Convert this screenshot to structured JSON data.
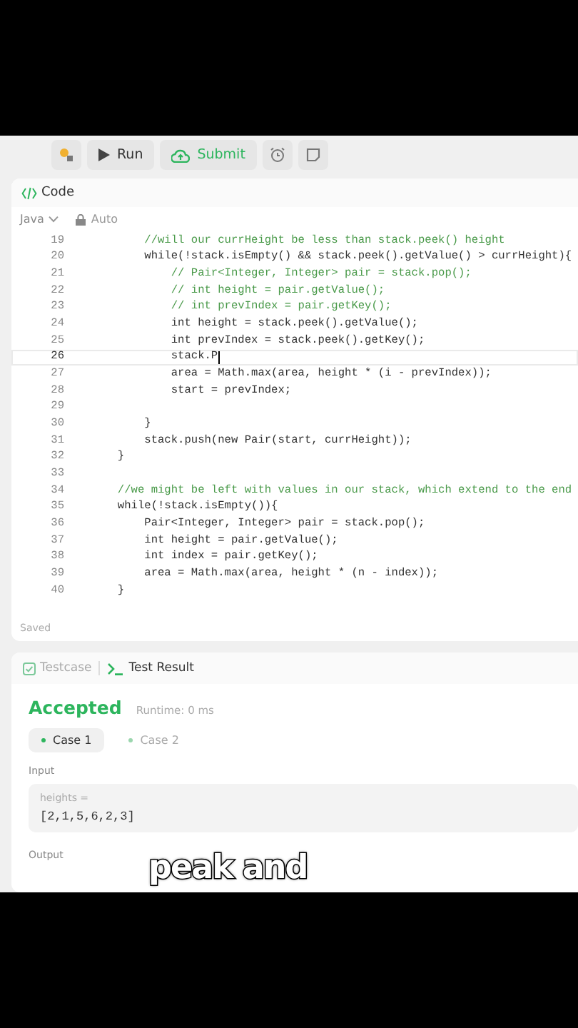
{
  "toolbar": {
    "buttons": [
      {
        "kind": "debug"
      },
      {
        "kind": "run",
        "label": "Run"
      },
      {
        "kind": "submit",
        "label": "Submit"
      },
      {
        "kind": "alarm"
      },
      {
        "kind": "note"
      }
    ]
  },
  "code_panel": {
    "title": "Code",
    "language": "Java",
    "mode": "Auto",
    "status": "Saved",
    "lines": [
      {
        "number": "19",
        "text": "            //will our currHeight be less than stack.peek() height",
        "kind": "comment",
        "current": false
      },
      {
        "number": "20",
        "text": "            while(!stack.isEmpty() && stack.peek().getValue() > currHeight){",
        "kind": "code",
        "current": false
      },
      {
        "number": "21",
        "text": "                // Pair<Integer, Integer> pair = stack.pop();",
        "kind": "comment",
        "current": false
      },
      {
        "number": "22",
        "text": "                // int height = pair.getValue();",
        "kind": "comment",
        "current": false
      },
      {
        "number": "23",
        "text": "                // int prevIndex = pair.getKey();",
        "kind": "comment",
        "current": false
      },
      {
        "number": "24",
        "text": "                int height = stack.peek().getValue();",
        "kind": "code",
        "current": false
      },
      {
        "number": "25",
        "text": "                int prevIndex = stack.peek().getKey();",
        "kind": "code",
        "current": false
      },
      {
        "number": "26",
        "text": "                stack.P",
        "kind": "code",
        "current": true
      },
      {
        "number": "27",
        "text": "                area = Math.max(area, height * (i - prevIndex));",
        "kind": "code",
        "current": false
      },
      {
        "number": "28",
        "text": "                start = prevIndex;",
        "kind": "code",
        "current": false
      },
      {
        "number": "29",
        "current": false
      },
      {
        "number": "30",
        "text": "            }",
        "kind": "code",
        "current": false
      },
      {
        "number": "31",
        "text": "            stack.push(new Pair(start, currHeight));",
        "kind": "code",
        "current": false
      },
      {
        "number": "32",
        "text": "        }",
        "kind": "code",
        "current": false
      },
      {
        "number": "33",
        "current": false
      },
      {
        "number": "34",
        "text": "        //we might be left with values in our stack, which extend to the end",
        "kind": "comment",
        "current": false
      },
      {
        "number": "35",
        "text": "        while(!stack.isEmpty()){",
        "kind": "code",
        "current": false
      },
      {
        "number": "36",
        "text": "            Pair<Integer, Integer> pair = stack.pop();",
        "kind": "code",
        "current": false
      },
      {
        "number": "37",
        "text": "            int height = pair.getValue();",
        "kind": "code",
        "current": false
      },
      {
        "number": "38",
        "text": "            int index = pair.getKey();",
        "kind": "code",
        "current": false
      },
      {
        "number": "39",
        "text": "            area = Math.max(area, height * (n - index));",
        "kind": "code",
        "current": false
      },
      {
        "number": "40",
        "text": "        }",
        "kind": "code",
        "current": false
      }
    ]
  },
  "result_panel": {
    "tabs": [
      {
        "label": "Testcase",
        "selected": false
      },
      {
        "label": "Test Result",
        "selected": true
      }
    ],
    "verdict": "Accepted",
    "runtime": "Runtime: 0 ms",
    "cases": [
      {
        "label": "Case 1",
        "selected": true
      },
      {
        "label": "Case 2",
        "selected": false
      }
    ],
    "input_label": "Input",
    "input_name": "heights =",
    "input_value": "[2,1,5,6,2,3]",
    "output_label": "Output"
  },
  "caption": "peak and"
}
